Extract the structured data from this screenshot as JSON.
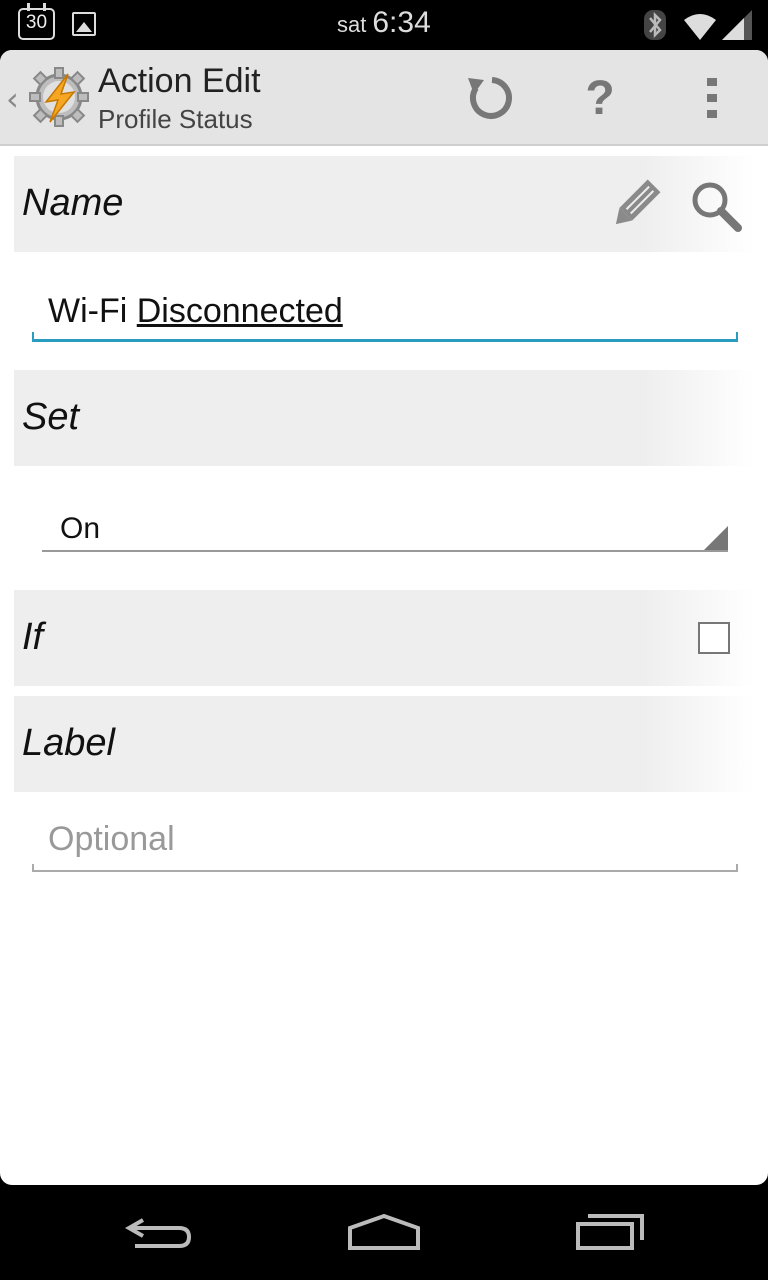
{
  "status_bar": {
    "calendar_day": "30",
    "day": "sat",
    "time": "6:34",
    "icons": [
      "calendar-icon",
      "image-icon",
      "bluetooth-icon",
      "wifi-icon",
      "signal-icon"
    ]
  },
  "action_bar": {
    "back_icon": "back-caret-icon",
    "app_icon": "tasker-icon",
    "title": "Action Edit",
    "subtitle": "Profile Status",
    "buttons": [
      "refresh-icon",
      "help-icon",
      "overflow-menu-icon"
    ],
    "help_glyph": "?"
  },
  "form": {
    "name_section": {
      "label": "Name",
      "icons": [
        "pencil-icon",
        "search-icon"
      ],
      "value_plain": "Wi-Fi ",
      "value_underlined": "Disconnected"
    },
    "set_section": {
      "label": "Set",
      "selected": "On"
    },
    "if_section": {
      "label": "If",
      "checked": false
    },
    "label_section": {
      "label": "Label",
      "placeholder": "Optional"
    }
  },
  "colors": {
    "accent": "#2a9cc0",
    "section_bg": "#eeeeee",
    "action_bar_bg": "#e4e4e4",
    "tasker_orange": "#f5a623"
  },
  "nav_bar": {
    "buttons": [
      "back-nav-icon",
      "home-nav-icon",
      "recents-nav-icon"
    ]
  }
}
